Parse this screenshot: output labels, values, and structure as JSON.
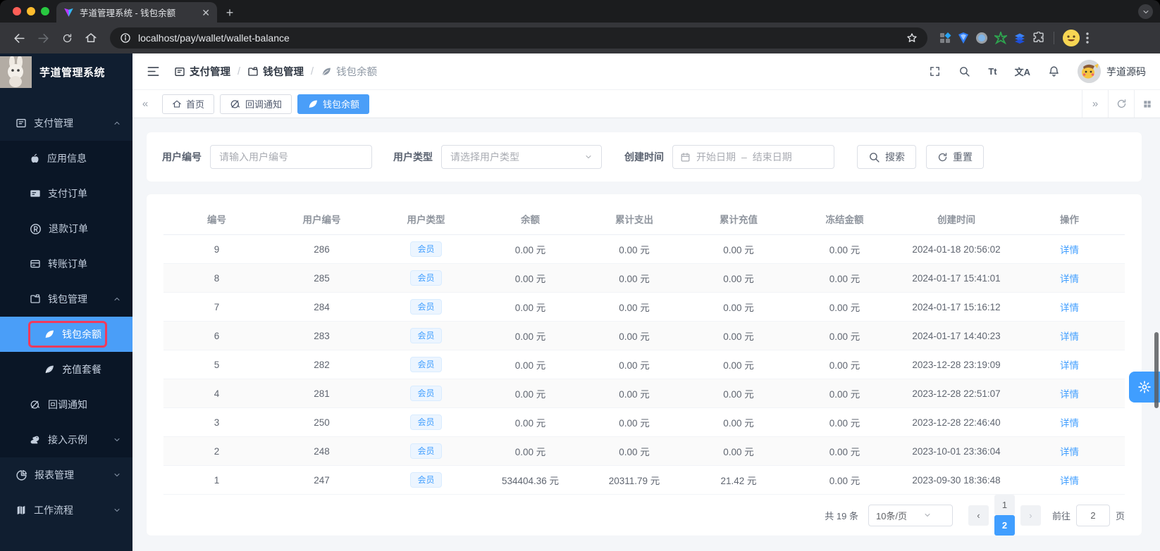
{
  "browser": {
    "tab_title": "芋道管理系统 - 钱包余额",
    "url": "localhost/pay/wallet/wallet-balance"
  },
  "sidebar": {
    "app_title": "芋道管理系统",
    "menu": [
      {
        "label": "支付管理",
        "icon": "payment",
        "level": 1,
        "chevron": "up",
        "sub": false
      },
      {
        "label": "应用信息",
        "icon": "apple",
        "level": 2,
        "chevron": "",
        "sub": true
      },
      {
        "label": "支付订单",
        "icon": "paycard",
        "level": 2,
        "chevron": "",
        "sub": true
      },
      {
        "label": "退款订单",
        "icon": "registered",
        "level": 2,
        "chevron": "",
        "sub": true
      },
      {
        "label": "转账订单",
        "icon": "transfer",
        "level": 2,
        "chevron": "",
        "sub": true
      },
      {
        "label": "钱包管理",
        "icon": "folder",
        "level": 2,
        "chevron": "up",
        "sub": true
      },
      {
        "label": "钱包余额",
        "icon": "leaf",
        "level": 3,
        "chevron": "",
        "sub": true,
        "active": true,
        "highlighted": true
      },
      {
        "label": "充值套餐",
        "icon": "leaf",
        "level": 3,
        "chevron": "",
        "sub": true
      },
      {
        "label": "回调通知",
        "icon": "notice",
        "level": 2,
        "chevron": "",
        "sub": true
      },
      {
        "label": "接入示例",
        "icon": "squirrel",
        "level": 2,
        "chevron": "down",
        "sub": true
      },
      {
        "label": "报表管理",
        "icon": "pie",
        "level": 1,
        "chevron": "down",
        "sub": false
      },
      {
        "label": "工作流程",
        "icon": "flow",
        "level": 1,
        "chevron": "down",
        "sub": false
      }
    ]
  },
  "header": {
    "breadcrumbs": [
      {
        "label": "支付管理",
        "icon": "payment"
      },
      {
        "label": "钱包管理",
        "icon": "folder"
      },
      {
        "label": "钱包余额",
        "icon": "leaf"
      }
    ],
    "username": "芋道源码"
  },
  "tags_bar": {
    "tabs": [
      {
        "label": "首页",
        "icon": "home",
        "active": false
      },
      {
        "label": "回调通知",
        "icon": "notice",
        "active": false
      },
      {
        "label": "钱包余额",
        "icon": "leaf",
        "active": true
      }
    ]
  },
  "filter": {
    "user_no_label": "用户编号",
    "user_no_placeholder": "请输入用户编号",
    "user_type_label": "用户类型",
    "user_type_placeholder": "请选择用户类型",
    "create_time_label": "创建时间",
    "date_start_placeholder": "开始日期",
    "date_separator": "–",
    "date_end_placeholder": "结束日期",
    "search_label": "搜索",
    "reset_label": "重置"
  },
  "table": {
    "columns": [
      "编号",
      "用户编号",
      "用户类型",
      "余额",
      "累计支出",
      "累计充值",
      "冻结金额",
      "创建时间",
      "操作"
    ],
    "rows": [
      {
        "id": "9",
        "user_no": "286",
        "user_type": "会员",
        "balance": "0.00 元",
        "expense": "0.00 元",
        "recharge": "0.00 元",
        "frozen": "0.00 元",
        "created": "2024-01-18 20:56:02",
        "action": "详情"
      },
      {
        "id": "8",
        "user_no": "285",
        "user_type": "会员",
        "balance": "0.00 元",
        "expense": "0.00 元",
        "recharge": "0.00 元",
        "frozen": "0.00 元",
        "created": "2024-01-17 15:41:01",
        "action": "详情"
      },
      {
        "id": "7",
        "user_no": "284",
        "user_type": "会员",
        "balance": "0.00 元",
        "expense": "0.00 元",
        "recharge": "0.00 元",
        "frozen": "0.00 元",
        "created": "2024-01-17 15:16:12",
        "action": "详情"
      },
      {
        "id": "6",
        "user_no": "283",
        "user_type": "会员",
        "balance": "0.00 元",
        "expense": "0.00 元",
        "recharge": "0.00 元",
        "frozen": "0.00 元",
        "created": "2024-01-17 14:40:23",
        "action": "详情"
      },
      {
        "id": "5",
        "user_no": "282",
        "user_type": "会员",
        "balance": "0.00 元",
        "expense": "0.00 元",
        "recharge": "0.00 元",
        "frozen": "0.00 元",
        "created": "2023-12-28 23:19:09",
        "action": "详情"
      },
      {
        "id": "4",
        "user_no": "281",
        "user_type": "会员",
        "balance": "0.00 元",
        "expense": "0.00 元",
        "recharge": "0.00 元",
        "frozen": "0.00 元",
        "created": "2023-12-28 22:51:07",
        "action": "详情"
      },
      {
        "id": "3",
        "user_no": "250",
        "user_type": "会员",
        "balance": "0.00 元",
        "expense": "0.00 元",
        "recharge": "0.00 元",
        "frozen": "0.00 元",
        "created": "2023-12-28 22:46:40",
        "action": "详情"
      },
      {
        "id": "2",
        "user_no": "248",
        "user_type": "会员",
        "balance": "0.00 元",
        "expense": "0.00 元",
        "recharge": "0.00 元",
        "frozen": "0.00 元",
        "created": "2023-10-01 23:36:04",
        "action": "详情"
      },
      {
        "id": "1",
        "user_no": "247",
        "user_type": "会员",
        "balance": "534404.36 元",
        "expense": "20311.79 元",
        "recharge": "21.42 元",
        "frozen": "0.00 元",
        "created": "2023-09-30 18:36:48",
        "action": "详情"
      }
    ]
  },
  "pagination": {
    "total": "共 19 条",
    "page_size": "10条/页",
    "pages": [
      "1",
      "2"
    ],
    "current": "2",
    "goto_label": "前往",
    "goto_value": "2",
    "unit_label": "页"
  },
  "icons_text": {
    "font_size": "Tt",
    "translate": "文A",
    "registered": "®"
  },
  "colors": {
    "accent": "#409eff",
    "sidebar_active": "#4a9ef8",
    "highlight_red": "#f23a5c",
    "sidebar_bg": "#101e30"
  }
}
